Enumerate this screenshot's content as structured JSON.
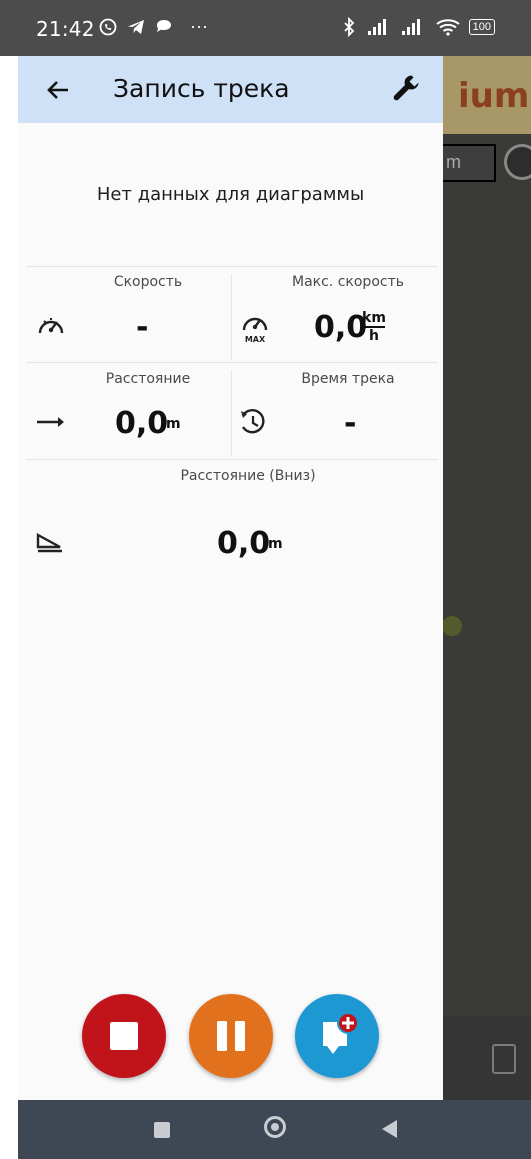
{
  "status_bar": {
    "time": "21:42",
    "more": "···",
    "battery": "100"
  },
  "app_bar": {
    "title": "Запись трека",
    "back_icon": "arrow-left-icon",
    "settings_icon": "wrench-icon"
  },
  "chart": {
    "empty_message": "Нет данных для диаграммы"
  },
  "stats": {
    "speed": {
      "label": "Скорость",
      "value": "-"
    },
    "max_speed": {
      "label": "Макс. скорость",
      "value": "0,0",
      "unit_top": "km",
      "unit_bottom": "h",
      "icon_badge": "MAX"
    },
    "distance": {
      "label": "Расстояние",
      "value": "0,0",
      "unit": "m"
    },
    "track_time": {
      "label": "Время трека",
      "value": "-"
    },
    "descent": {
      "label": "Расстояние (Вниз)",
      "value": "0,0",
      "unit": "m"
    }
  },
  "actions": {
    "stop": "stop-icon",
    "pause": "pause-icon",
    "add_note": "add-note-icon"
  },
  "background_map": {
    "partial_text": "ium!",
    "field_text": "m"
  },
  "colors": {
    "app_bar": "#cfe1f6",
    "stop": "#c0141a",
    "pause": "#e2711d",
    "note": "#1e98d3",
    "nav_bar": "#3e4754"
  }
}
